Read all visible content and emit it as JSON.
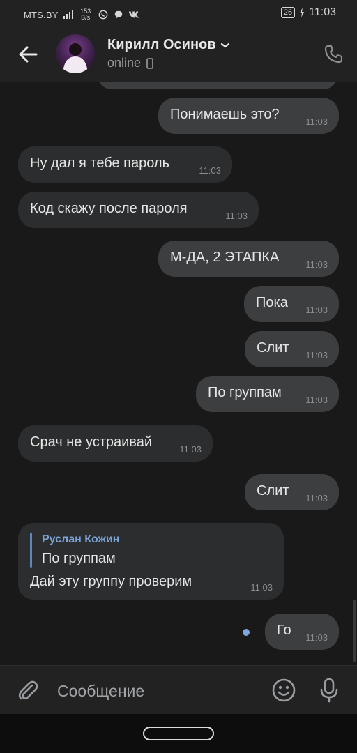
{
  "status_bar": {
    "carrier": "MTS.BY",
    "net_speed_value": "153",
    "net_speed_unit": "B/s",
    "battery": "26",
    "time": "11:03"
  },
  "header": {
    "contact_name": "Кирилл Осинов",
    "status": "online"
  },
  "messages": [
    {
      "direction": "out",
      "text": "Понимаешь это?",
      "time": "11:03"
    },
    {
      "direction": "in",
      "text": "Ну дал я тебе пароль",
      "time": "11:03"
    },
    {
      "direction": "in",
      "text": "Код скажу после пароля",
      "time": "11:03"
    },
    {
      "direction": "out",
      "text": "М-ДА, 2 ЭТАПКА",
      "time": "11:03"
    },
    {
      "direction": "out",
      "text": "Пока",
      "time": "11:03"
    },
    {
      "direction": "out",
      "text": "Слит",
      "time": "11:03"
    },
    {
      "direction": "out",
      "text": "По группам",
      "time": "11:03"
    },
    {
      "direction": "in",
      "text": "Срач не устраивай",
      "time": "11:03"
    },
    {
      "direction": "out",
      "text": "Слит",
      "time": "11:03"
    },
    {
      "direction": "in",
      "reply_author": "Руслан Кожин",
      "reply_text": "По группам",
      "text": "Дай эту группу проверим",
      "time": "11:03"
    },
    {
      "direction": "out",
      "text": "Го",
      "time": "11:03",
      "unread": true
    }
  ],
  "composer": {
    "placeholder": "Сообщение"
  },
  "colors": {
    "background": "#191919",
    "bar": "#222222",
    "incoming_bubble": "#2c2d2e",
    "outgoing_bubble": "#3d3e40",
    "accent": "#7aa4d6"
  }
}
